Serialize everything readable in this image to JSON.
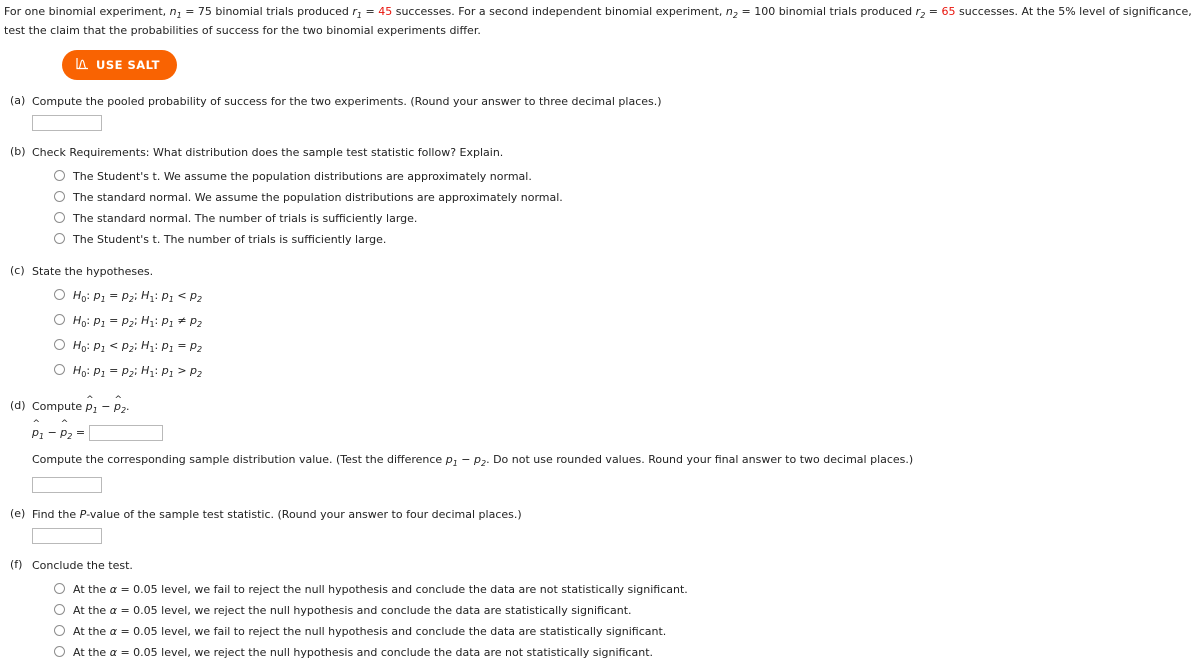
{
  "problem": {
    "text_1": "For one binomial experiment, ",
    "n1_sym": "n",
    "n1_sub": "1",
    "n1_eq": " = 75 binomial trials produced ",
    "r1_sym": "r",
    "r1_sub": "1",
    "r1_eq": " = ",
    "r1_value": "45",
    "text_2": " successes. For a second independent binomial experiment, ",
    "n2_sym": "n",
    "n2_sub": "2",
    "n2_eq": " = 100 binomial trials produced ",
    "r2_sym": "r",
    "r2_sub": "2",
    "r2_eq": " = ",
    "r2_value": "65",
    "text_3": " successes. At the 5% level of significance, test the claim that the probabilities of success for the two binomial experiments differ."
  },
  "salt": {
    "label": "USE SALT",
    "color": "#f96302",
    "icon": "distribution-curve-icon"
  },
  "parts": {
    "a": {
      "letter": "(a)",
      "question": "Compute the pooled probability of success for the two experiments. (Round your answer to three decimal places.)",
      "answer_value": "",
      "placeholder": ""
    },
    "b": {
      "letter": "(b)",
      "question": "Check Requirements: What distribution does the sample test statistic follow? Explain.",
      "options": [
        "The Student's t. We assume the population distributions are approximately normal.",
        "The standard normal. We assume the population distributions are approximately normal.",
        "The standard normal. The number of trials is sufficiently large.",
        "The Student's t. The number of trials is sufficiently large."
      ]
    },
    "c": {
      "letter": "(c)",
      "question": "State the hypotheses.",
      "options": [
        {
          "h0": "H0: p1 = p2",
          "h1": "H1: p1 < p2",
          "h0_op": "=",
          "h1_op": "<"
        },
        {
          "h0": "H0: p1 = p2",
          "h1": "H1: p1 ≠ p2",
          "h0_op": "=",
          "h1_op": "≠"
        },
        {
          "h0": "H0: p1 < p2",
          "h1": "H1: p1 = p2",
          "h0_op": "<",
          "h1_op": "="
        },
        {
          "h0": "H0: p1 = p2",
          "h1": "H1: p1 > p2",
          "h0_op": "=",
          "h1_op": ">"
        }
      ]
    },
    "d": {
      "letter": "(d)",
      "question_prefix": "Compute ",
      "question_math": "p̂1 − p̂2.",
      "equation_label": "p̂1 − p̂2 =",
      "answer_value_1": "",
      "sub_question": "Compute the corresponding sample distribution value. (Test the difference p1 − p2. Do not use rounded values. Round your final answer to two decimal places.)",
      "answer_value_2": ""
    },
    "e": {
      "letter": "(e)",
      "question_pre": "Find the ",
      "question_p": "P",
      "question_post": "-value of the sample test statistic. (Round your answer to four decimal places.)",
      "answer_value": ""
    },
    "f": {
      "letter": "(f)",
      "question": "Conclude the test.",
      "options": [
        "= 0.05 level, we fail to reject the null hypothesis and conclude the data are not statistically significant.",
        "= 0.05 level, we reject the null hypothesis and conclude the data are statistically significant.",
        "= 0.05 level, we fail to reject the null hypothesis and conclude the data are statistically significant.",
        "= 0.05 level, we reject the null hypothesis and conclude the data are not statistically significant."
      ],
      "option_prefix": "At the ",
      "alpha": "α"
    }
  }
}
